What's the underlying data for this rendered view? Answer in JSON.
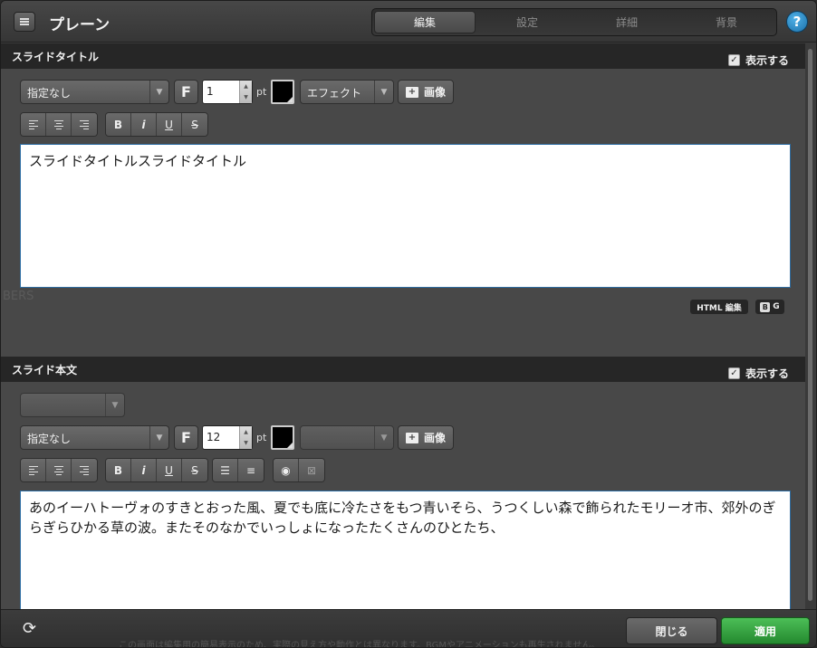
{
  "header": {
    "title": "プレーン",
    "tabs": [
      {
        "label": "編集",
        "active": true
      },
      {
        "label": "設定",
        "active": false
      },
      {
        "label": "詳細",
        "active": false
      },
      {
        "label": "背景",
        "active": false
      }
    ],
    "help_label": "?"
  },
  "title_section": {
    "heading": "スライドタイトル",
    "show_label": "表示する",
    "show_checked": true,
    "font_select": "指定なし",
    "font_button": "F",
    "size_value": "1",
    "size_unit": "pt",
    "text_color": "#000000",
    "effect_select": "エフェクト",
    "image_button": "画像",
    "bold": "B",
    "italic": "i",
    "underline": "U",
    "strike": "S",
    "content": "スライドタイトルスライドタイトル",
    "html_edit": "HTML 編集",
    "bg_label": "G"
  },
  "body_section": {
    "heading": "スライド本文",
    "show_label": "表示する",
    "show_checked": true,
    "font_select": "指定なし",
    "font_button": "F",
    "size_value": "12",
    "size_unit": "pt",
    "text_color": "#000000",
    "image_button": "画像",
    "bold": "B",
    "italic": "i",
    "underline": "U",
    "strike": "S",
    "content": "あのイーハトーヴォのすきとおった風、夏でも底に冷たさをもつ青いそら、うつくしい森で飾られたモリーオ市、郊外のぎらぎらひかる草の波。またそのなかでいっしょになったたくさんのひとたち、"
  },
  "background_text": {
    "bers": "BERS"
  },
  "footer": {
    "close_label": "閉じる",
    "apply_label": "適用",
    "note": "この画面は編集用の簡易表示のため、実際の見え方や動作とは異なります。BGMやアニメーションも再生されません。"
  },
  "colors": {
    "accent_green": "#2fa43a",
    "help_blue": "#2a8fd0"
  }
}
